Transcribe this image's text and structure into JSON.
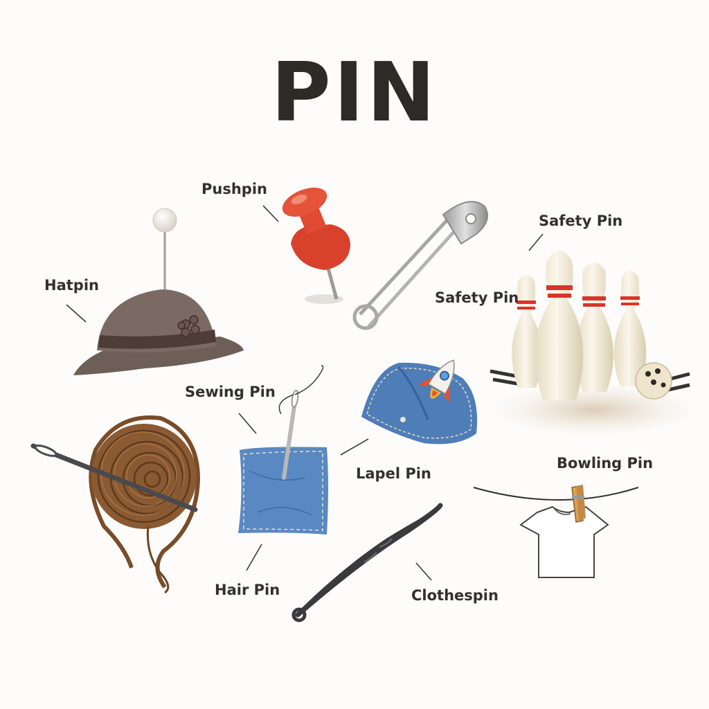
{
  "title": "PIN",
  "labels": {
    "pushpin": "Pushpin",
    "safety_pin_top": "Safety Pin",
    "safety_pin_mid": "Safety Pin",
    "hatpin": "Hatpin",
    "sewing_pin": "Sewing Pin",
    "lapel_pin": "Lapel Pin",
    "bowling_pin": "Bowling Pin",
    "hair_pin": "Hair Pin",
    "clothespin": "Clothespin"
  },
  "colors": {
    "background": "#fdfcfa",
    "text": "#33302d",
    "pushpin_red": "#e04a33",
    "denim": "#4f7db8",
    "hat": "#7b6a63",
    "hair": "#8a5a32",
    "bowling_pin": "#f1e8d2",
    "bowling_stripe": "#d9342b",
    "hairpin": "#3a3a3e"
  },
  "icons": [
    "pushpin-icon",
    "safety-pin-icon",
    "bowling-pins-icon",
    "hat-icon",
    "hair-bun-icon",
    "fabric-pin-icon",
    "lapel-pin-icon",
    "hair-pin-icon",
    "clothespin-icon"
  ]
}
